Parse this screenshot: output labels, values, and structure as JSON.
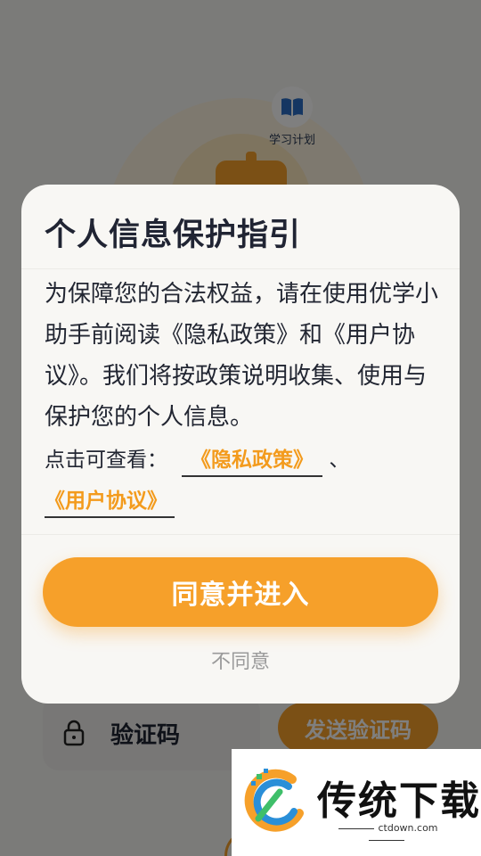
{
  "background": {
    "plan_label": "学习计划",
    "code_label": "验证码",
    "send_code_label": "发送验证码"
  },
  "dialog": {
    "title": "个人信息保护指引",
    "body": "为保障您的合法权益，请在使用优学小助手前阅读《隐私政策》和《用户协议》。我们将按政策说明收集、使用与保护您的个人信息。",
    "links_prefix": "点击可查看：",
    "privacy_link": "《隐私政策》",
    "separator": "、",
    "agreement_link": "《用户协议》",
    "agree_label": "同意并进入",
    "disagree_label": "不同意"
  },
  "watermark": {
    "name": "传统下载",
    "site": "ctdown.com"
  },
  "colors": {
    "accent": "#f6a02a",
    "link": "#f39b1d",
    "title": "#202433",
    "muted": "#9a9a9a"
  },
  "icons": {
    "plan": "book-icon",
    "code": "lock-icon"
  }
}
